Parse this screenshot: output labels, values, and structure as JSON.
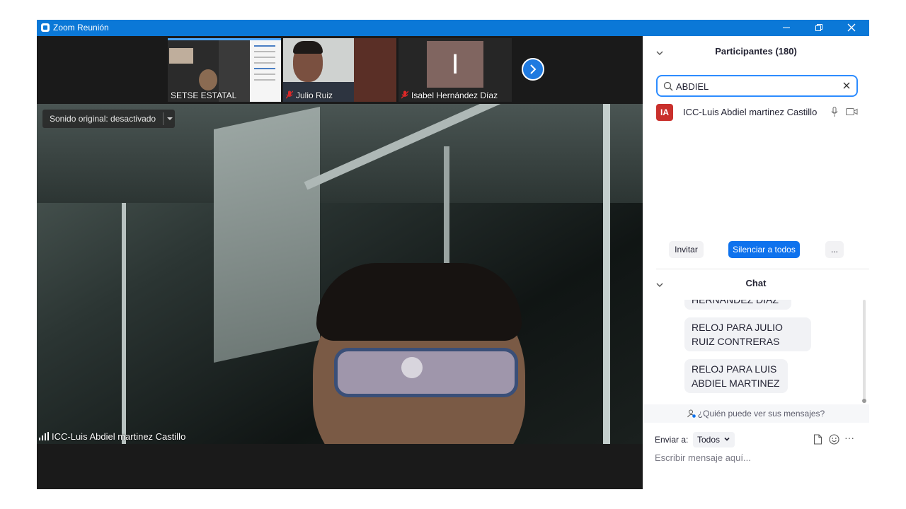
{
  "window": {
    "title": "Zoom Reunión"
  },
  "gallery": {
    "thumbnails": [
      {
        "name": "SETSE ESTATAL",
        "muted": false
      },
      {
        "name": "Julio Ruiz",
        "muted": true
      },
      {
        "name": "Isabel Hernández Díaz",
        "muted": true,
        "avatar_letter": "I"
      }
    ]
  },
  "main_video": {
    "original_sound": "Sonido original: desactivado",
    "speaker_name": "ICC-Luis Abdiel martinez Castillo"
  },
  "participants": {
    "title": "Participantes (180)",
    "search_value": "ABDIEL",
    "list": [
      {
        "initials": "IA",
        "name": "ICC-Luis Abdiel martinez Castillo",
        "avatar_color": "#c9302c"
      }
    ],
    "invite_label": "Invitar",
    "mute_all_label": "Silenciar a todos",
    "more_label": "..."
  },
  "chat": {
    "title": "Chat",
    "messages": [
      {
        "text": "HERNANDEZ DIAZ"
      },
      {
        "text": "RELOJ PARA JULIO RUIZ CONTRERAS"
      },
      {
        "text": "RELOJ PARA LUIS ABDIEL MARTINEZ"
      }
    ],
    "who_can_see": "¿Quién puede ver sus mensajes?",
    "send_to_label": "Enviar a:",
    "send_to_value": "Todos",
    "more_label": "···",
    "input_placeholder": "Escribir mensaje aquí..."
  },
  "colors": {
    "titlebar": "#0b78d7",
    "accent": "#0e72ed",
    "search_border": "#2d8cff"
  }
}
